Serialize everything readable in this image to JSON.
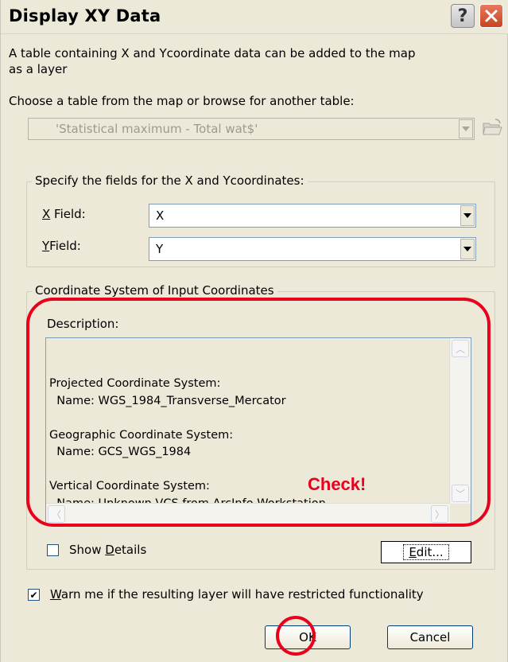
{
  "window": {
    "title": "Display XY Data",
    "help_glyph": "?",
    "close_icon": "close-icon",
    "help_icon": "help-icon"
  },
  "intro": {
    "line1": "A table containing X and Ycoordinate data can be added to the map",
    "line2": "as a layer"
  },
  "table_chooser": {
    "label": "Choose a table from the map or browse for another table:",
    "selected_value": "'Statistical maximum - Total wat$'",
    "browse_icon": "open-folder-icon"
  },
  "xy_fields": {
    "group_label": "Specify the fields for the X and Ycoordinates:",
    "x_label_key": "X",
    "x_label_rest": " Field:",
    "x_value": "X",
    "y_label_key": "Y",
    "y_label_rest": "Field:",
    "y_value": "Y"
  },
  "coordinate_system": {
    "group_label": "Coordinate System of Input Coordinates",
    "description_label": "Description:",
    "lines": [
      "Projected Coordinate System:",
      "  Name: WGS_1984_Transverse_Mercator",
      "",
      "Geographic Coordinate System:",
      "  Name: GCS_WGS_1984",
      "",
      "Vertical Coordinate System:",
      "  Name: Unknown VCS from ArcInfo Workstation"
    ],
    "show_details_prefix": "Show ",
    "show_details_key": "D",
    "show_details_rest": "etails",
    "show_details_checked": false,
    "edit_prefix": "",
    "edit_key": "E",
    "edit_rest": "dit..."
  },
  "annotation": {
    "check_label": "Check!",
    "color": "#e8001c"
  },
  "warning": {
    "checked": true,
    "check_glyph": "✔",
    "key": "W",
    "rest": "arn me if the resulting layer will have restricted functionality"
  },
  "buttons": {
    "ok": "OK",
    "cancel": "Cancel"
  }
}
